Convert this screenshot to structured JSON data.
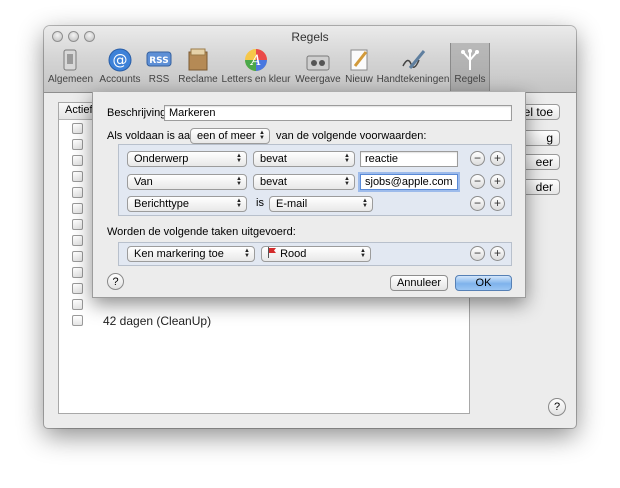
{
  "window": {
    "title": "Regels"
  },
  "toolbar": {
    "items": [
      {
        "label": "Algemeen",
        "icon": "general-icon"
      },
      {
        "label": "Accounts",
        "icon": "at-icon"
      },
      {
        "label": "RSS",
        "icon": "rss-icon",
        "badge": "RSS"
      },
      {
        "label": "Reclame",
        "icon": "junk-mail-icon"
      },
      {
        "label": "Letters en kleur",
        "icon": "fonts-colors-icon",
        "glyph": "A"
      },
      {
        "label": "Weergave",
        "icon": "viewing-icon"
      },
      {
        "label": "Nieuw",
        "icon": "composing-icon"
      },
      {
        "label": "Handtekeningen",
        "icon": "signature-icon"
      },
      {
        "label": "Regels",
        "icon": "rules-icon"
      }
    ]
  },
  "rules_list": {
    "header": "Actief",
    "rows": [
      {
        "name": "",
        "checked": false
      },
      {
        "name": "",
        "checked": false
      },
      {
        "name": "",
        "checked": false
      },
      {
        "name": "",
        "checked": false
      },
      {
        "name": "",
        "checked": false
      },
      {
        "name": "",
        "checked": false
      },
      {
        "name": "",
        "checked": false
      },
      {
        "name": "",
        "checked": false
      },
      {
        "name": "",
        "checked": false
      },
      {
        "name": "",
        "checked": false
      },
      {
        "name": "",
        "checked": false
      },
      {
        "name": "",
        "checked": false
      },
      {
        "name": "42 dagen (CleanUp)",
        "checked": false
      }
    ]
  },
  "side_buttons": {
    "add": "el toe",
    "edit": "g",
    "duplicate": "eer",
    "remove": "der"
  },
  "sheet": {
    "description_label": "Beschrijving:",
    "description_value": "Markeren",
    "match_prefix": "Als voldaan is aan",
    "match_value": "een of meer",
    "match_suffix": "van de volgende voorwaarden:",
    "conditions": [
      {
        "field": "Onderwerp",
        "operator": "bevat",
        "value": "reactie"
      },
      {
        "field": "Van",
        "operator": "bevat",
        "value": "sjobs@apple.com"
      },
      {
        "field": "Berichttype",
        "operator": "is",
        "value": "E-mail"
      }
    ],
    "actions_label": "Worden de volgende taken uitgevoerd:",
    "action": {
      "type": "Ken markering toe",
      "value": "Rood",
      "flag_color": "#d42b2b"
    },
    "cancel": "Annuleer",
    "ok": "OK",
    "help": "?"
  },
  "help": "?"
}
